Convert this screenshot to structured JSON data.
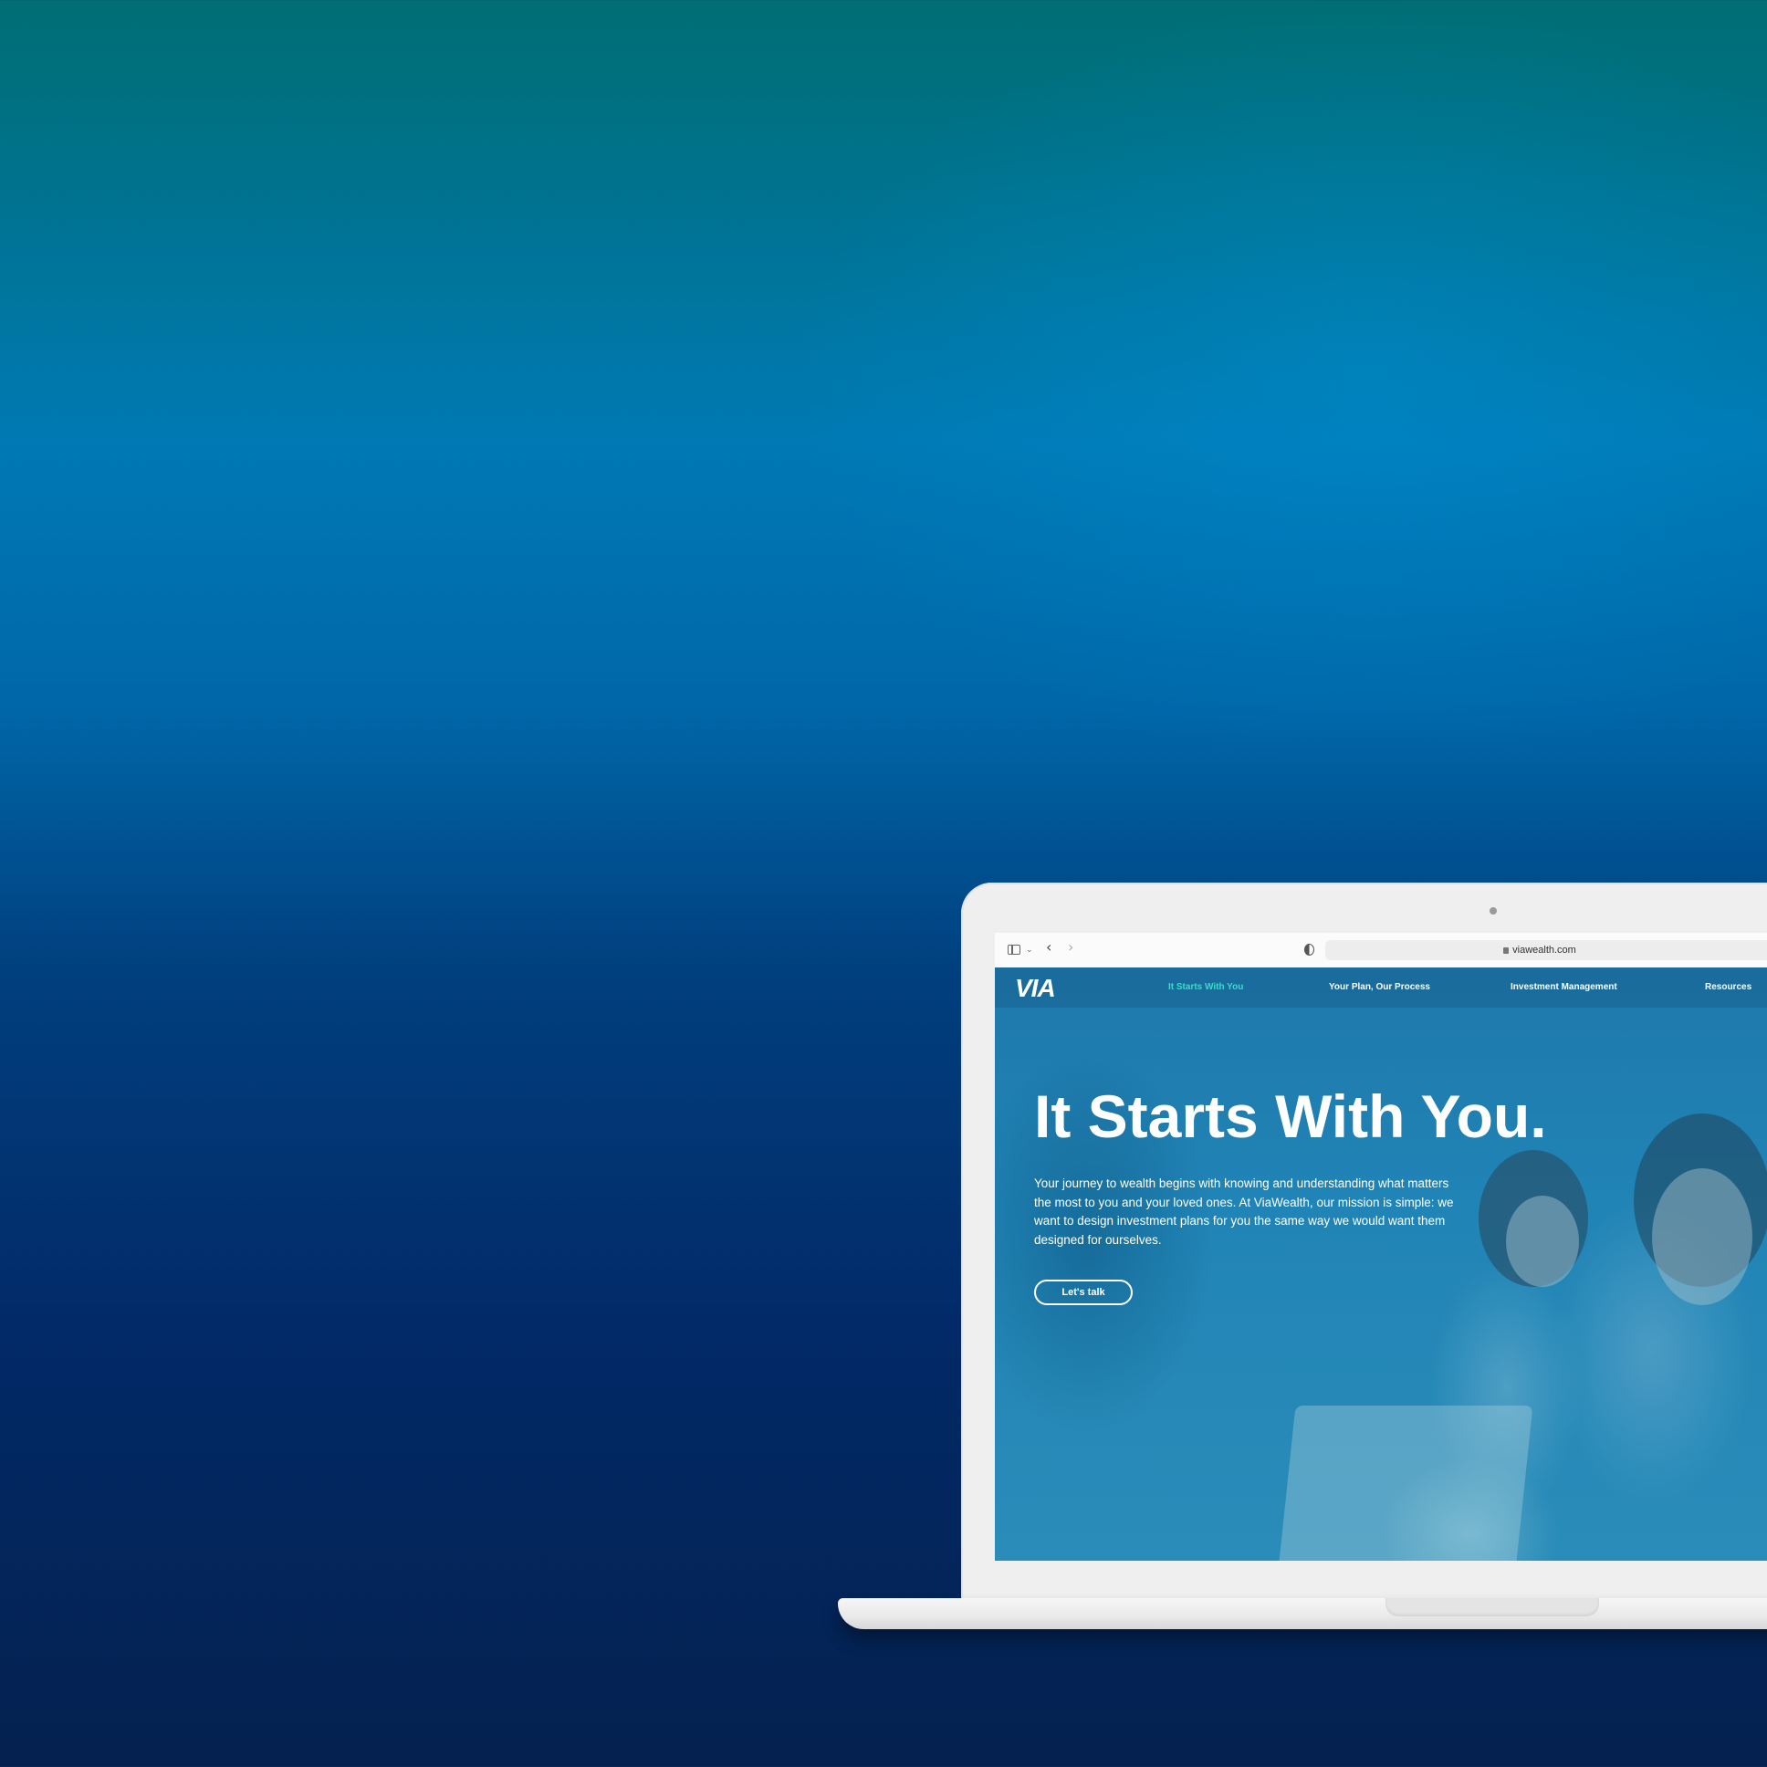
{
  "browser": {
    "url": "viawealth.com"
  },
  "site": {
    "logo": "VIA",
    "nav": [
      {
        "label": "It Starts With You",
        "active": true
      },
      {
        "label": "Your Plan, Our Process",
        "active": false
      },
      {
        "label": "Investment Management",
        "active": false
      },
      {
        "label": "Resources",
        "active": false
      }
    ],
    "headline": "It Starts With You.",
    "body": "Your journey to wealth begins with knowing and understanding what matters the most to you and your loved ones. At ViaWealth, our mission is simple: we want to design investment plans for you the same way we would want them designed for ourselves.",
    "cta_label": "Let's talk"
  },
  "colors": {
    "accent": "#30e0c8",
    "background_top": "#006e73",
    "background_bottom": "#04214f"
  }
}
